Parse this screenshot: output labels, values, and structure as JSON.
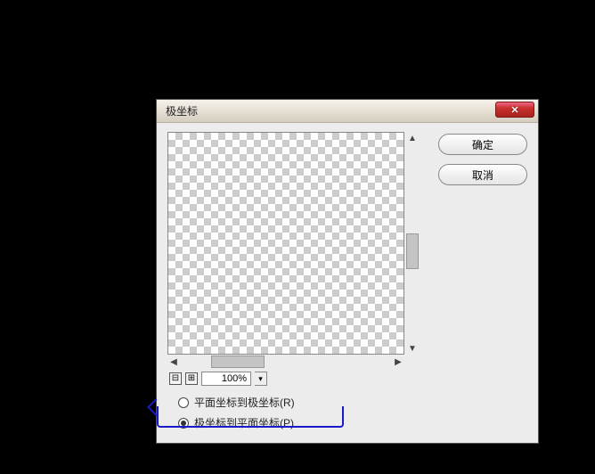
{
  "dialog": {
    "title": "极坐标",
    "close_glyph": "✕"
  },
  "zoom": {
    "minus": "⊟",
    "plus": "⊞",
    "value": "100%",
    "dropdown_glyph": "▾"
  },
  "scroll": {
    "up": "▲",
    "down": "▼",
    "left": "◀",
    "right": "▶"
  },
  "options": {
    "rect_to_polar": "平面坐标到极坐标(R)",
    "polar_to_rect": "极坐标到平面坐标(P)",
    "selected": "polar_to_rect"
  },
  "buttons": {
    "ok": "确定",
    "cancel": "取消"
  }
}
